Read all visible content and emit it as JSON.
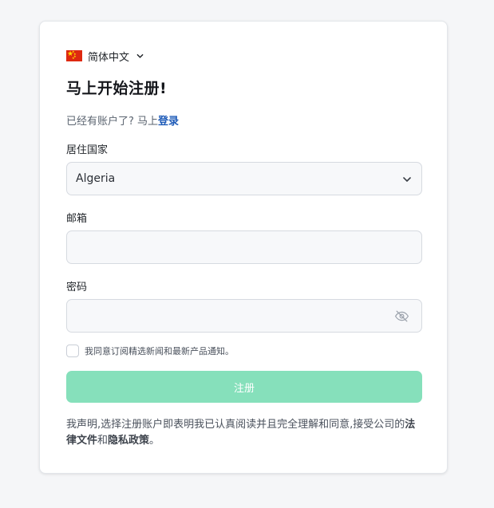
{
  "language": {
    "label": "简体中文",
    "flag": "china-flag"
  },
  "heading": "马上开始注册!",
  "login_prompt": {
    "text": "已经有账户了? 马上",
    "link": "登录"
  },
  "country": {
    "label": "居住国家",
    "value": "Algeria"
  },
  "email": {
    "label": "邮箱",
    "value": "",
    "placeholder": ""
  },
  "password": {
    "label": "密码",
    "value": "",
    "placeholder": ""
  },
  "consent": {
    "checked": false,
    "text": "我同意订阅精选新闻和最新产品通知。"
  },
  "submit_label": "注册",
  "terms": {
    "prefix": "我声明,选择注册账户即表明我已认真阅读并且完全理解和同意,接受公司的",
    "legal_link": "法律文件",
    "conjunction": "和",
    "privacy_link": "隐私政策",
    "suffix": "。"
  },
  "colors": {
    "accent_link": "#1e5bb8",
    "submit_bg": "#86e0bb",
    "field_bg": "#f7f8fa"
  }
}
